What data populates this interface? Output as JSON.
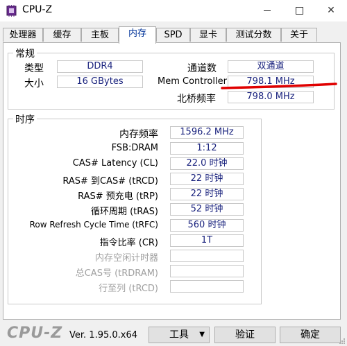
{
  "window": {
    "title": "CPU-Z"
  },
  "tabs": [
    {
      "label": "处理器"
    },
    {
      "label": "缓存"
    },
    {
      "label": "主板"
    },
    {
      "label": "内存"
    },
    {
      "label": "SPD"
    },
    {
      "label": "显卡"
    },
    {
      "label": "测试分数"
    },
    {
      "label": "关于"
    }
  ],
  "general": {
    "title": "常规",
    "type_label": "类型",
    "type_value": "DDR4",
    "size_label": "大小",
    "size_value": "16 GBytes",
    "channels_label": "通道数",
    "channels_value": "双通道",
    "mem_controller_label": "Mem Controller",
    "mem_controller_value": "798.1 MHz",
    "northbridge_label": "北桥频率",
    "northbridge_value": "798.0 MHz"
  },
  "timings": {
    "title": "时序",
    "rows": [
      {
        "label": "内存频率",
        "value": "1596.2 MHz"
      },
      {
        "label": "FSB:DRAM",
        "value": "1:12"
      },
      {
        "label": "CAS# Latency (CL)",
        "value": "22.0 时钟"
      },
      {
        "label": "RAS# 到CAS# (tRCD)",
        "value": "22 时钟"
      },
      {
        "label": "RAS# 预充电 (tRP)",
        "value": "22 时钟"
      },
      {
        "label": "循环周期 (tRAS)",
        "value": "52 时钟"
      },
      {
        "label": "Row Refresh Cycle Time (tRFC)",
        "value": "560 时钟"
      },
      {
        "label": "指令比率 (CR)",
        "value": "1T"
      },
      {
        "label": "内存空闲计时器",
        "value": ""
      },
      {
        "label": "总CAS号 (tRDRAM)",
        "value": ""
      },
      {
        "label": "行至列 (tRCD)",
        "value": ""
      }
    ]
  },
  "footer": {
    "logo": "CPU-Z",
    "version": "Ver. 1.95.0.x64",
    "tools_label": "工具",
    "verify_label": "验证",
    "ok_label": "确定"
  },
  "colors": {
    "value_text": "#1a237e",
    "active_tab_text": "#003399",
    "annotation": "#e00000"
  }
}
